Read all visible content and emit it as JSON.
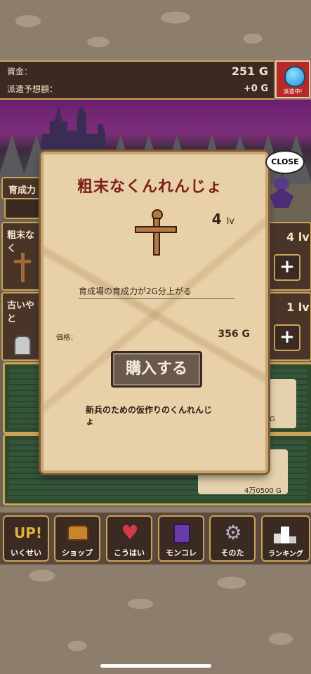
{
  "header": {
    "funds_label": "資金：",
    "funds_value": "251 G",
    "dispatch_estimate_label": "派遣予想額：",
    "dispatch_estimate_value": "+0 G",
    "dispatch_status": "派遣中!"
  },
  "left_panel": {
    "tab_label": "育成力",
    "item1_name": "粗末なく",
    "item1_level": "4 lv",
    "item2_name": "古いやと",
    "item2_level": "1 lv",
    "plus_symbol": "+"
  },
  "background_values": {
    "card1_value": "G",
    "card2_value": "4万0500 G",
    "close_partial": "SE"
  },
  "modal": {
    "title": "粗末なくんれんじょ",
    "level_number": "4",
    "level_unit": "lv",
    "effect_text": "育成場の育成力が2G分上がる",
    "price_label": "価格：",
    "price_value": "356 G",
    "buy_button": "購入する",
    "flavor_text": "新兵のための仮作りのくんれんじょ",
    "close_label": "CLOSE"
  },
  "nav": [
    {
      "label": "いくせい",
      "icon": "up-icon"
    },
    {
      "label": "ショップ",
      "icon": "chest-icon"
    },
    {
      "label": "こうはい",
      "icon": "heart-icon"
    },
    {
      "label": "モンコレ",
      "icon": "book-icon"
    },
    {
      "label": "そのた",
      "icon": "gear-icon"
    },
    {
      "label": "ランキング",
      "icon": "podium-icon"
    }
  ],
  "nav_up_text": "UP!",
  "colors": {
    "accent_red": "#7a1f1a",
    "dispatch_red": "#b72929",
    "gold_border": "#c9a458"
  }
}
